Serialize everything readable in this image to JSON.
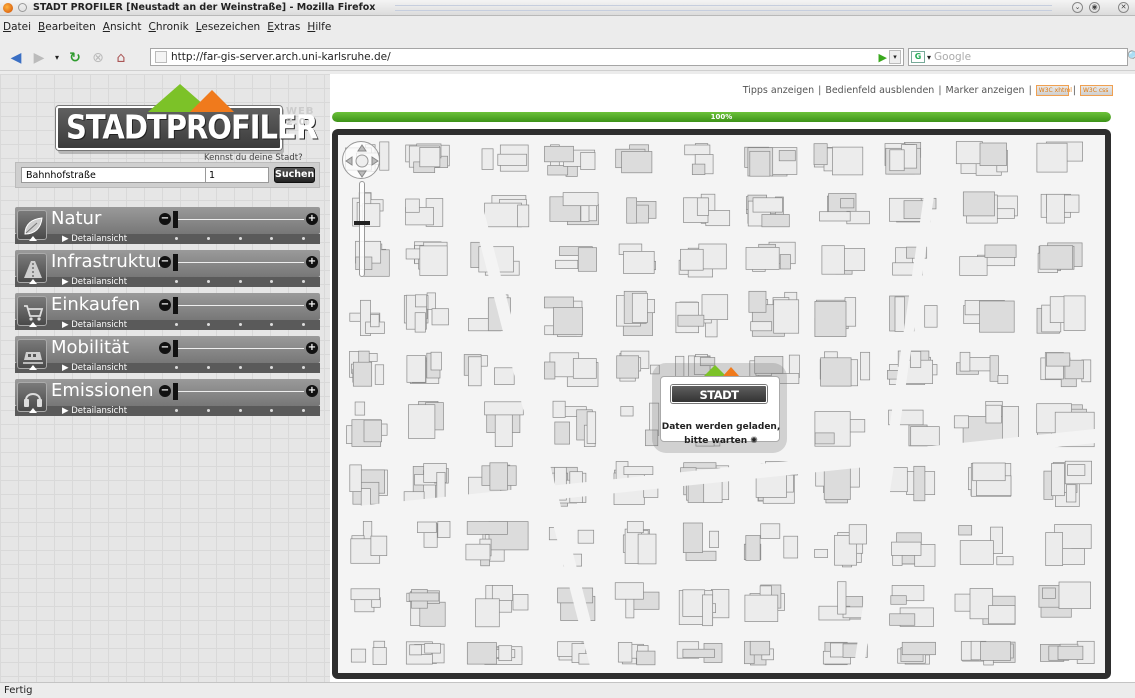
{
  "window": {
    "title": "STADT PROFILER  [Neustadt an der Weinstraße] - Mozilla Firefox"
  },
  "menu": [
    "Datei",
    "Bearbeiten",
    "Ansicht",
    "Chronik",
    "Lesezeichen",
    "Extras",
    "Hilfe"
  ],
  "navbar": {
    "url": "http://far-gis-server.arch.uni-karlsruhe.de/",
    "search_placeholder": "Google",
    "search_engine_icon": "google-icon"
  },
  "logo": {
    "text": "STADTPROFILER",
    "tagline": "Kennst du deine Stadt?",
    "badge": "WEB 2.0"
  },
  "search": {
    "street_value": "Bahnhofstraße",
    "number_value": "1",
    "button_label": "Suchen"
  },
  "categories": [
    {
      "name": "Natur",
      "detail": "Detailansicht",
      "icon": "leaf-icon"
    },
    {
      "name": "Infrastruktur",
      "detail": "Detailansicht",
      "icon": "road-icon"
    },
    {
      "name": "Einkaufen",
      "detail": "Detailansicht",
      "icon": "cart-icon"
    },
    {
      "name": "Mobilität",
      "detail": "Detailansicht",
      "icon": "train-icon"
    },
    {
      "name": "Emissionen",
      "detail": "Detailansicht",
      "icon": "headphones-icon"
    }
  ],
  "toplinks": {
    "tips": "Tipps anzeigen",
    "panel": "Bedienfeld ausblenden",
    "markers": "Marker anzeigen",
    "badge1": "W3C xhtml",
    "badge2": "W3C css"
  },
  "progress": {
    "label": "100%",
    "value": 1.0
  },
  "loading": {
    "logo": "STADT PROFILER",
    "line1": "Daten werden geladen,",
    "line2": "bitte warten"
  },
  "status": {
    "text": "Fertig"
  },
  "colors": {
    "accent_green": "#7cc228",
    "accent_orange": "#f07a1c",
    "progress_green": "#3d9318"
  }
}
